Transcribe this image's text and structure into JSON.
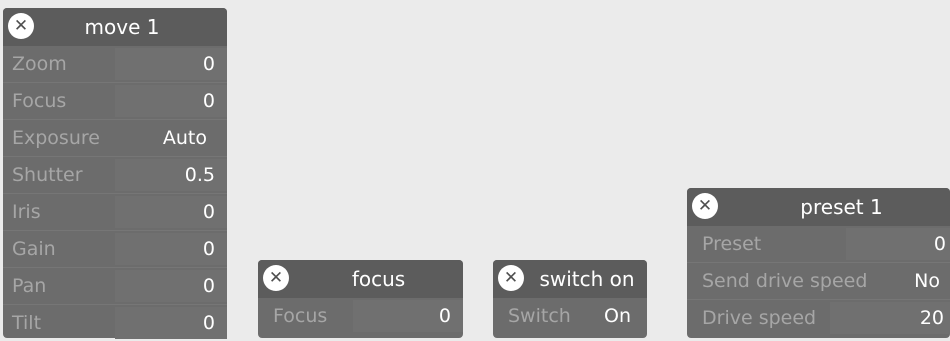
{
  "panels": {
    "move1": {
      "title": "move 1",
      "rows": [
        {
          "label": "Zoom",
          "value": "0"
        },
        {
          "label": "Focus",
          "value": "0"
        },
        {
          "label": "Exposure",
          "value": "Auto"
        },
        {
          "label": "Shutter",
          "value": "0.5"
        },
        {
          "label": "Iris",
          "value": "0"
        },
        {
          "label": "Gain",
          "value": "0"
        },
        {
          "label": "Pan",
          "value": "0"
        },
        {
          "label": "Tilt",
          "value": "0"
        }
      ]
    },
    "focus": {
      "title": "focus",
      "rows": [
        {
          "label": "Focus",
          "value": "0"
        }
      ]
    },
    "switch_on": {
      "title": "switch on",
      "rows": [
        {
          "label": "Switch",
          "value": "On"
        }
      ]
    },
    "preset1": {
      "title": "preset 1",
      "rows": [
        {
          "label": "Preset",
          "value": "0"
        },
        {
          "label": "Send drive speed",
          "value": "No"
        },
        {
          "label": "Drive speed",
          "value": "20"
        }
      ]
    }
  },
  "icons": {
    "close": "close-icon"
  }
}
